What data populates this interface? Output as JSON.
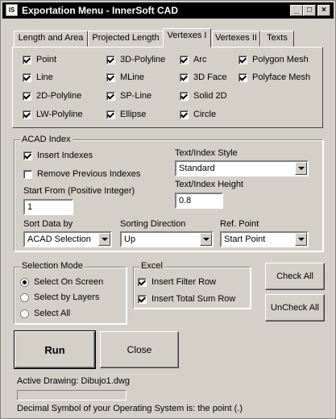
{
  "window": {
    "title": "Exportation Menu - InnerSoft CAD",
    "icon_text": "IS",
    "minimize_glyph": "_",
    "maximize_glyph": "□",
    "close_glyph": "×"
  },
  "tabs": [
    {
      "label": "Length and Area"
    },
    {
      "label": "Projected Length"
    },
    {
      "label": "Vertexes I"
    },
    {
      "label": "Vertexes II"
    },
    {
      "label": "Texts"
    }
  ],
  "entity_checks": [
    {
      "label": "Point",
      "checked": true
    },
    {
      "label": "Line",
      "checked": true
    },
    {
      "label": "2D-Polyline",
      "checked": true
    },
    {
      "label": "LW-Polyline",
      "checked": true
    },
    {
      "label": "3D-Polyline",
      "checked": true
    },
    {
      "label": "MLine",
      "checked": true
    },
    {
      "label": "SP-Line",
      "checked": true
    },
    {
      "label": "Ellipse",
      "checked": true
    },
    {
      "label": "Arc",
      "checked": true
    },
    {
      "label": "3D Face",
      "checked": true
    },
    {
      "label": "Solid 2D",
      "checked": true
    },
    {
      "label": "Circle",
      "checked": true
    },
    {
      "label": "Polygon Mesh",
      "checked": true
    },
    {
      "label": "Polyface Mesh",
      "checked": true
    }
  ],
  "acad_index": {
    "group_label": "ACAD Index",
    "insert_indexes": {
      "label": "Insert Indexes",
      "checked": true
    },
    "remove_previous": {
      "label": "Remove Previous Indexes",
      "checked": false
    },
    "start_from_label": "Start From (Positive Integer)",
    "start_from_value": "1",
    "style_label": "Text/Index Style",
    "style_value": "Standard",
    "height_label": "Text/Index Height",
    "height_value": "0.8",
    "sort_data_label": "Sort Data by",
    "sort_data_value": "ACAD Selection",
    "sort_dir_label": "Sorting Direction",
    "sort_dir_value": "Up",
    "ref_point_label": "Ref. Point",
    "ref_point_value": "Start Point"
  },
  "selection_mode": {
    "group_label": "Selection Mode",
    "options": [
      {
        "label": "Select On Screen",
        "selected": true
      },
      {
        "label": "Select by Layers",
        "selected": false
      },
      {
        "label": "Select All",
        "selected": false
      }
    ]
  },
  "excel": {
    "group_label": "Excel",
    "insert_filter_row": {
      "label": "Insert Filter Row",
      "checked": true
    },
    "insert_total_sum_row": {
      "label": "Insert Total Sum Row",
      "checked": true
    }
  },
  "buttons": {
    "check_all": "Check All",
    "uncheck_all": "UnCheck All",
    "run": "Run",
    "close": "Close"
  },
  "status": {
    "active_drawing": "Active Drawing: Dibujo1.dwg",
    "progress": 0,
    "decimal_symbol": "Decimal Symbol of your Operating System is: the point (.)"
  }
}
